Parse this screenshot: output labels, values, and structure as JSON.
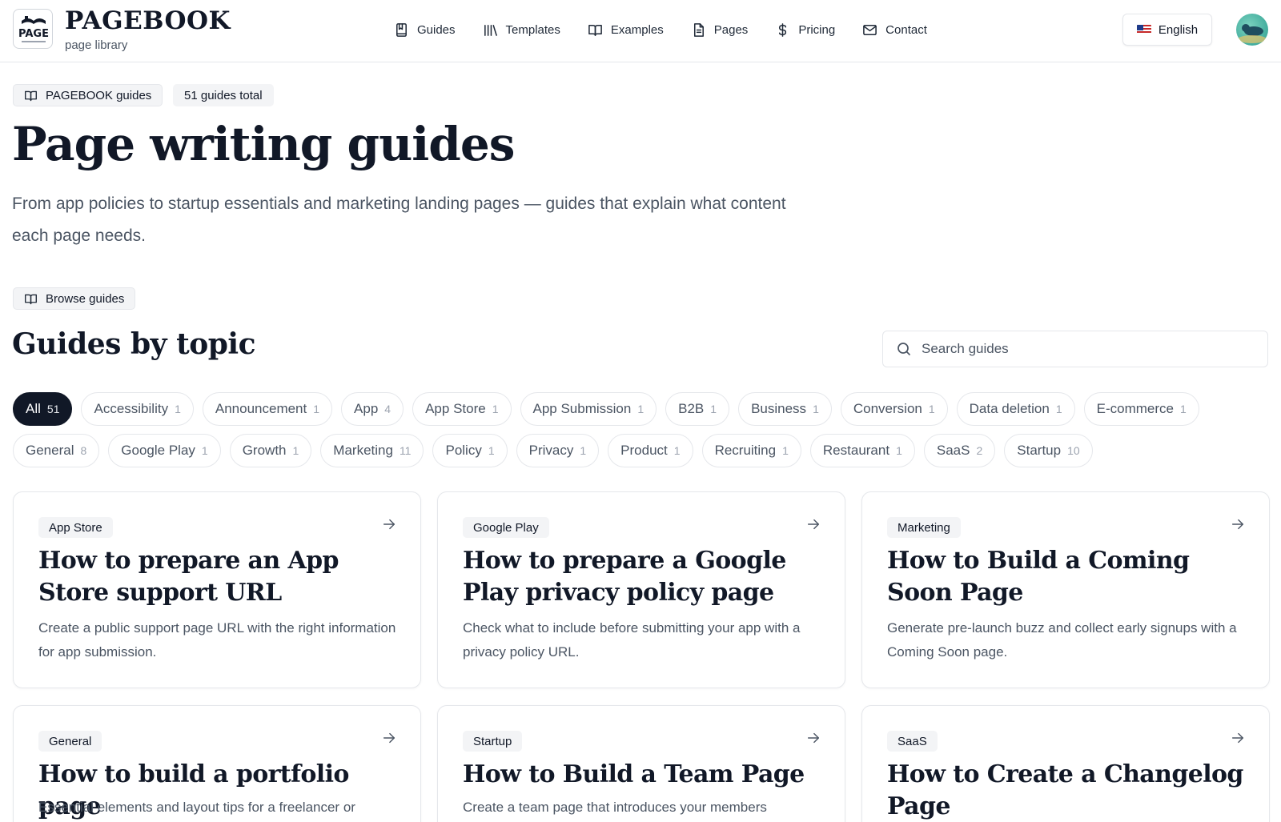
{
  "header": {
    "brand_name": "PAGEBOOK",
    "brand_sub": "page library",
    "logo_text": "PAGE",
    "nav": [
      {
        "label": "Guides",
        "icon": "bookmark-book-icon"
      },
      {
        "label": "Templates",
        "icon": "library-icon"
      },
      {
        "label": "Examples",
        "icon": "open-book-icon"
      },
      {
        "label": "Pages",
        "icon": "document-icon"
      },
      {
        "label": "Pricing",
        "icon": "dollar-icon"
      },
      {
        "label": "Contact",
        "icon": "mail-icon"
      }
    ],
    "language": "English"
  },
  "hero": {
    "badge_label": "PAGEBOOK guides",
    "total_label": "51 guides total",
    "title": "Page writing guides",
    "description": "From app policies to startup essentials and marketing landing pages — guides that explain what content each page needs."
  },
  "browse": {
    "badge_label": "Browse guides",
    "title": "Guides by topic",
    "search_placeholder": "Search guides"
  },
  "filters_row1": [
    {
      "label": "All",
      "count": "51",
      "active": true
    },
    {
      "label": "Accessibility",
      "count": "1"
    },
    {
      "label": "Announcement",
      "count": "1"
    },
    {
      "label": "App",
      "count": "4"
    },
    {
      "label": "App Store",
      "count": "1"
    },
    {
      "label": "App Submission",
      "count": "1"
    },
    {
      "label": "B2B",
      "count": "1"
    },
    {
      "label": "Business",
      "count": "1"
    },
    {
      "label": "Conversion",
      "count": "1"
    },
    {
      "label": "Data deletion",
      "count": "1"
    },
    {
      "label": "E-commerce",
      "count": "1"
    }
  ],
  "filters_row2": [
    {
      "label": "General",
      "count": "8"
    },
    {
      "label": "Google Play",
      "count": "1"
    },
    {
      "label": "Growth",
      "count": "1"
    },
    {
      "label": "Marketing",
      "count": "11"
    },
    {
      "label": "Policy",
      "count": "1"
    },
    {
      "label": "Privacy",
      "count": "1"
    },
    {
      "label": "Product",
      "count": "1"
    },
    {
      "label": "Recruiting",
      "count": "1"
    },
    {
      "label": "Restaurant",
      "count": "1"
    },
    {
      "label": "SaaS",
      "count": "2"
    },
    {
      "label": "Startup",
      "count": "10"
    }
  ],
  "cards": [
    {
      "tag": "App Store",
      "title": "How to prepare an App Store support URL",
      "desc": "Create a public support page URL with the right information for app submission."
    },
    {
      "tag": "Google Play",
      "title": "How to prepare a Google Play privacy policy page",
      "desc": "Check what to include before submitting your app with a privacy policy URL."
    },
    {
      "tag": "Marketing",
      "title": "How to Build a Coming Soon Page",
      "desc": "Generate pre-launch buzz and collect early signups with a Coming Soon page."
    },
    {
      "tag": "General",
      "title": "How to build a portfolio page",
      "desc": "Essential elements and layout tips for a freelancer or"
    },
    {
      "tag": "Startup",
      "title": "How to Build a Team Page",
      "desc": "Create a team page that introduces your members"
    },
    {
      "tag": "SaaS",
      "title": "How to Create a Changelog Page",
      "desc": ""
    }
  ]
}
